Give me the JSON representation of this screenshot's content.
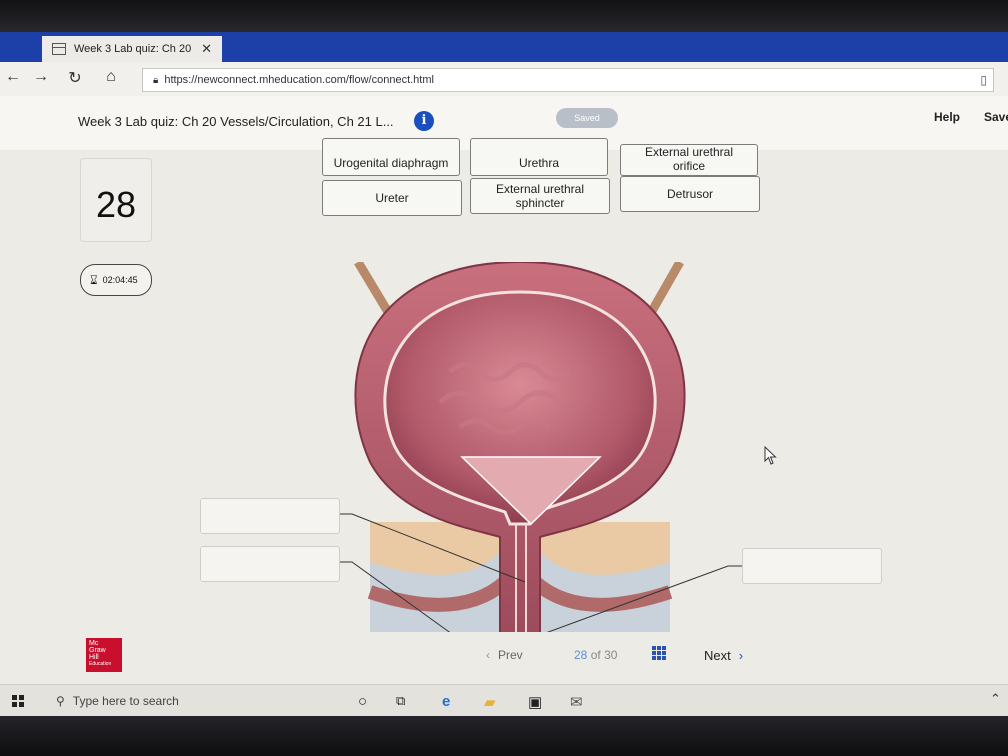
{
  "browser": {
    "tab_title": "Week 3 Lab quiz: Ch 20",
    "tab_close": "✕",
    "back": "←",
    "forward": "→",
    "refresh": "↻",
    "home": "⌂",
    "url": "https://newconnect.mheducation.com/flow/connect.html"
  },
  "header": {
    "quiz_title": "Week 3 Lab quiz: Ch 20 Vessels/Circulation, Ch 21 L...",
    "info_glyph": "i",
    "saved": "Saved",
    "help": "Help",
    "save": "Save"
  },
  "question": {
    "number": "28",
    "timer": "02:04:45"
  },
  "labels": {
    "row1": [
      "Urogenital diaphragm",
      "Urethra",
      "External urethral\norifice"
    ],
    "row2": [
      "Ureter",
      "External urethral\nsphincter",
      "Detrusor"
    ]
  },
  "footer": {
    "logo_lines": [
      "Mc",
      "Graw",
      "Hill",
      "Education"
    ],
    "prev": "Prev",
    "current_page": "28",
    "of_text": "of",
    "total_pages": "30",
    "next": "Next"
  },
  "taskbar": {
    "search_placeholder": "Type here to search"
  },
  "colors": {
    "accent": "#1b4fbf",
    "tabbar": "#1d3fa8",
    "brand_red": "#c8102e"
  },
  "icons": [
    "tab-page-icon",
    "lock-icon",
    "reading-view-icon",
    "info-icon",
    "hourglass-icon",
    "chevron-left-icon",
    "grid-icon",
    "chevron-right-icon",
    "windows-logo-icon",
    "search-icon",
    "cortana-icon",
    "task-view-icon",
    "edge-icon",
    "file-explorer-icon",
    "store-icon",
    "mail-icon",
    "chevron-up-icon",
    "mouse-cursor-icon"
  ]
}
